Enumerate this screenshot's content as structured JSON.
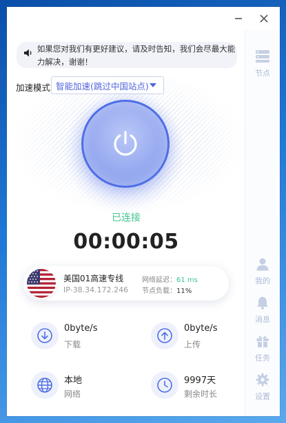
{
  "notice": {
    "icon": "speaker-icon",
    "text": "如果您对我们有更好建议，请及时告知，我们会尽最大能力解决，谢谢！"
  },
  "mode": {
    "label": "加速模式",
    "value": "智能加速(跳过中国站点)"
  },
  "connection": {
    "status": "已连接",
    "timer": "00:00:05"
  },
  "server": {
    "name": "美国01高速专线",
    "ip": "IP-38.34.172.246",
    "latency_label": "网络延迟：",
    "latency_value": "61 ms",
    "load_label": "节点负载：",
    "load_value": "11%"
  },
  "stats": {
    "download": {
      "value": "0byte/s",
      "label": "下载"
    },
    "upload": {
      "value": "0byte/s",
      "label": "上传"
    },
    "network": {
      "value": "本地",
      "label": "网络"
    },
    "remaining": {
      "value": "9997天",
      "label": "剩余时长"
    }
  },
  "sidebar": {
    "nodes": "节点",
    "me": "我的",
    "messages": "消息",
    "tasks": "任务",
    "settings": "设置"
  },
  "colors": {
    "accent": "#4e6ee6",
    "connected": "#3cc58d",
    "sidebar_icon": "#aebbd6"
  }
}
